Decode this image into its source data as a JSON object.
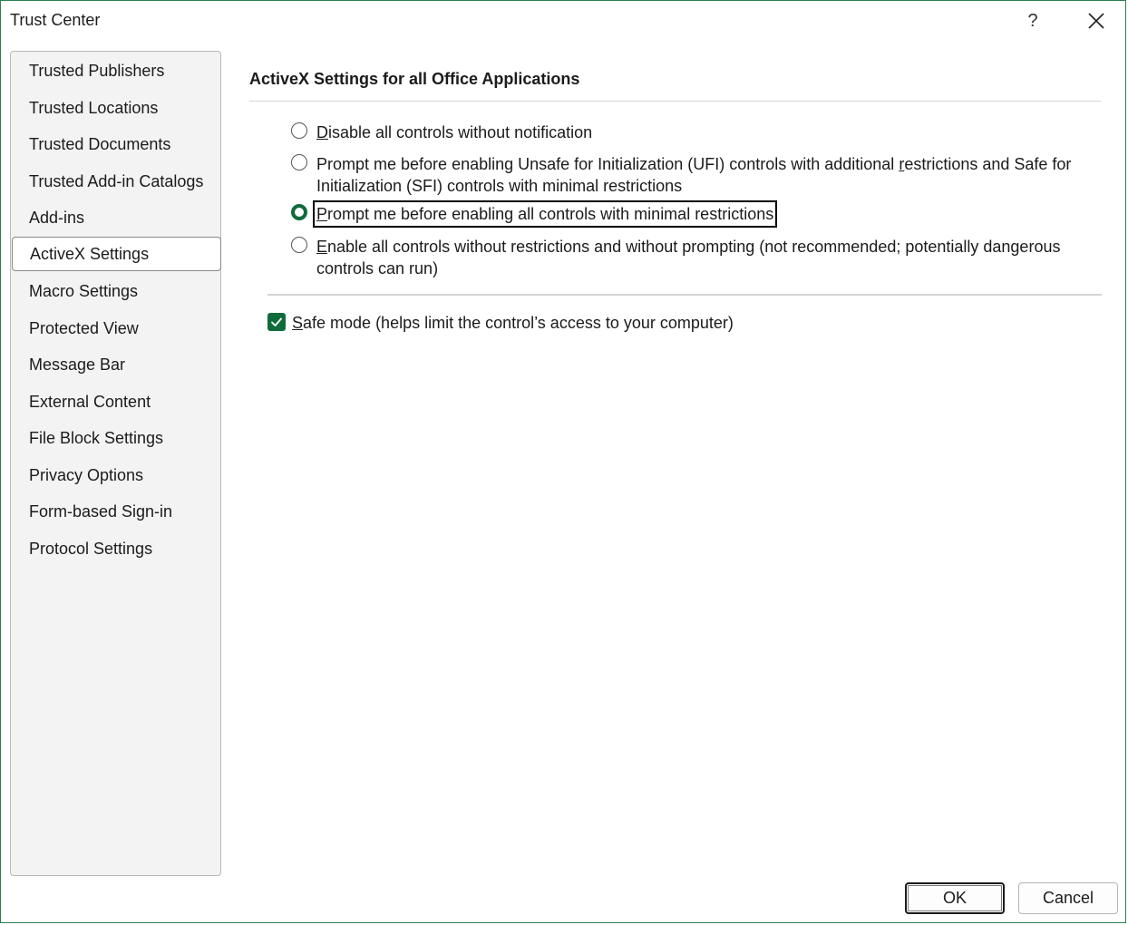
{
  "window": {
    "title": "Trust Center",
    "help_label": "?",
    "accent_color": "#0f6c3a"
  },
  "sidebar": {
    "items": [
      {
        "label": "Trusted Publishers"
      },
      {
        "label": "Trusted Locations"
      },
      {
        "label": "Trusted Documents"
      },
      {
        "label": "Trusted Add-in Catalogs"
      },
      {
        "label": "Add-ins"
      },
      {
        "label": "ActiveX Settings",
        "selected": true
      },
      {
        "label": "Macro Settings"
      },
      {
        "label": "Protected View"
      },
      {
        "label": "Message Bar"
      },
      {
        "label": "External Content"
      },
      {
        "label": "File Block Settings"
      },
      {
        "label": "Privacy Options"
      },
      {
        "label": "Form-based Sign-in"
      },
      {
        "label": "Protocol Settings"
      }
    ]
  },
  "main": {
    "section_title": "ActiveX Settings for all Office Applications",
    "options": [
      {
        "pre": "",
        "accel": "D",
        "post": "isable all controls without notification",
        "checked": false
      },
      {
        "pre": "Prompt me before enabling Unsafe for Initialization (UFI) controls with additional ",
        "accel": "r",
        "post": "estrictions and Safe for",
        "line2": "Initialization (SFI) controls with minimal restrictions",
        "checked": false
      },
      {
        "pre": "",
        "accel": "P",
        "post": "rompt me before enabling all controls with minimal restrictions",
        "checked": true,
        "focused": true
      },
      {
        "pre": "",
        "accel": "E",
        "post": "nable all controls without restrictions and without prompting (not recommended; potentially dangerous",
        "line2": "controls can run)",
        "checked": false
      }
    ],
    "safe_mode": {
      "accel": "S",
      "label_rest": "afe mode (helps limit the control’s access to your computer)",
      "checked": true
    }
  },
  "footer": {
    "ok_label": "OK",
    "cancel_label": "Cancel"
  }
}
